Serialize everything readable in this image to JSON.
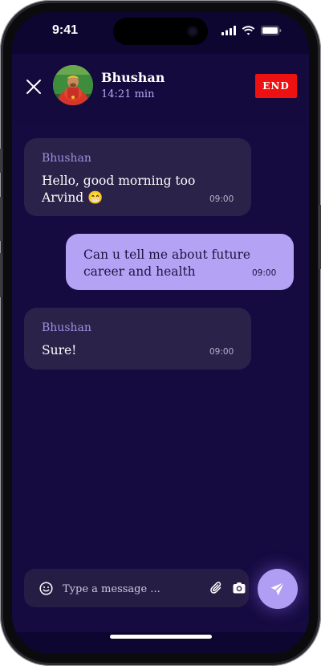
{
  "status_bar": {
    "time": "9:41"
  },
  "header": {
    "contact_name": "Bhushan",
    "call_duration": "14:21 min",
    "end_label": "END"
  },
  "messages": [
    {
      "direction": "incoming",
      "sender": "Bhushan",
      "text": "Hello, good morning too Arvind 😁",
      "time": "09:00"
    },
    {
      "direction": "outgoing",
      "text": "Can u tell me about future career and health",
      "time": "09:00"
    },
    {
      "direction": "incoming",
      "sender": "Bhushan",
      "text": "Sure!",
      "time": "09:00"
    }
  ],
  "composer": {
    "placeholder": "Type a message ..."
  },
  "icons": {
    "close": "close-icon",
    "emoji": "smiley-icon",
    "attach": "paperclip-icon",
    "camera": "camera-icon",
    "send": "send-icon"
  },
  "colors": {
    "background": "#150b40",
    "end_button": "#ee1111",
    "incoming_bubble": "#2a2248",
    "outgoing_bubble": "#b4a3f5",
    "accent": "#b09ef4"
  }
}
